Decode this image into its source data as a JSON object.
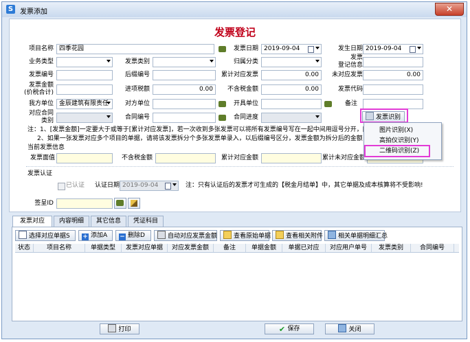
{
  "window": {
    "title": "发票添加",
    "close_glyph": "✕"
  },
  "form": {
    "title": "发票登记",
    "project_name": {
      "label": "项目名称",
      "value": "四季花园"
    },
    "invoice_date": {
      "label": "发票日期",
      "value": "2019-09-04"
    },
    "issue_date": {
      "label": "发生日期",
      "value": "2019-09-04"
    },
    "biz_type": {
      "label": "业务类型",
      "value": ""
    },
    "invoice_category": {
      "label": "发票类别",
      "value": ""
    },
    "belong_category": {
      "label": "归属分类",
      "value": ""
    },
    "reg_info": {
      "label": "发票\n登记信息",
      "value": ""
    },
    "invoice_no": {
      "label": "发票编号",
      "value": ""
    },
    "suffix_no": {
      "label": "后缀编号",
      "value": ""
    },
    "cum_matched": {
      "label": "累计对应发票",
      "value": "0.00"
    },
    "unmatched": {
      "label": "未对应发票",
      "value": "0.00"
    },
    "amount": {
      "label": "发票金额\n(价税合计)",
      "value": ""
    },
    "input_tax": {
      "label": "进项税额",
      "value": "0.00"
    },
    "ex_tax_amount": {
      "label": "不含税金额",
      "value": "0.00"
    },
    "invoice_code": {
      "label": "发票代码",
      "value": ""
    },
    "our_unit": {
      "label": "我方单位",
      "value": "金辰建筑有限责任"
    },
    "counterparty": {
      "label": "对方单位",
      "value": ""
    },
    "issuer": {
      "label": "开具单位",
      "value": ""
    },
    "remark": {
      "label": "备注",
      "value": ""
    },
    "contract_category": {
      "label": "对应合同\n类别",
      "value": ""
    },
    "contract_no": {
      "label": "合同编号",
      "value": ""
    },
    "contract_progress": {
      "label": "合同进度",
      "value": ""
    },
    "recognize_button": "发票识别",
    "notes": [
      "注：1、[发票金额]一定要大于或等于[累计对应发票]，若一次收到多张发票可以将所有发票编号写在一起中间用逗号分开，[发",
      "2、如果一张发票对应多个项目的单据，请将该发票拆分个多张发票单录入，以后缀编号区分，发票金额为拆分后的金额"
    ],
    "current_info": {
      "title": "当前发票信息",
      "face_value_label": "发票面值",
      "ex_tax_label": "不含税金额",
      "cum_label": "累计对应金额",
      "cum_unmatched_label": "累计未对应金额"
    },
    "cert": {
      "title": "发票认证",
      "checkbox_label": "已认证",
      "date_label": "认证日期",
      "date_value": "2019-09-04",
      "note": "注：只有认证后的发票才可生成的【税金月结单】中，其它单据及成本核算将不受影响!"
    },
    "sign": {
      "label": "签呈ID",
      "value": ""
    }
  },
  "context_menu": {
    "items": [
      "图片识别(X)",
      "高拍仪识别(Y)",
      "二维码识别(Z)"
    ]
  },
  "tabs": [
    {
      "label": "发票对应"
    },
    {
      "label": "内容明细"
    },
    {
      "label": "其它信息"
    },
    {
      "label": "凭证科目"
    }
  ],
  "toolbar": {
    "select": "选择对应单据S",
    "add": "添加A",
    "delete": "删除D",
    "auto": "自动对应发票金额",
    "view_orig": "查看原始单据",
    "view_attach": "查看相关附件",
    "summary": "相关单据明细汇总"
  },
  "grid": {
    "columns": [
      "状态",
      "项目名称",
      "单据类型",
      "发票对应单据",
      "对应发票金额",
      "备注",
      "单据金额",
      "单据已对应",
      "对应用户单号",
      "发票类别",
      "合同编号"
    ]
  },
  "bottom": {
    "print": "打印",
    "save": "保存",
    "close": "关闭"
  },
  "colors": {
    "title_red": "#c0001a",
    "highlight": "#e23bd6",
    "flag_green": "#5f7d2a"
  }
}
